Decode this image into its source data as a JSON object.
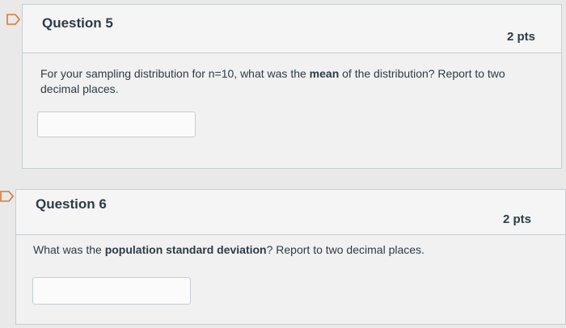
{
  "questions": [
    {
      "title": "Question 5",
      "points": "2 pts",
      "text_before": "For your sampling distribution for n=10, what was the ",
      "text_bold": "mean",
      "text_after": " of the distribution? Report to two decimal places.",
      "answer_value": ""
    },
    {
      "title": "Question 6",
      "points": "2 pts",
      "text_before": "What was the ",
      "text_bold": "population standard deviation",
      "text_after": "? Report to two decimal places.",
      "answer_value": ""
    }
  ],
  "icons": {
    "flag": "flag-question-icon"
  },
  "colors": {
    "flag_outline": "#e0762e",
    "border": "#c7cdd1",
    "text": "#2d3b45"
  }
}
